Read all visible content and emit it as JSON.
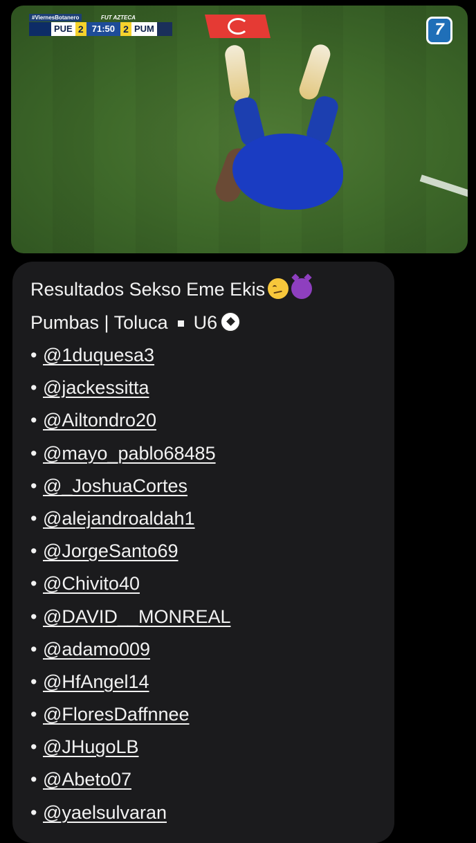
{
  "media": {
    "scoreboard": {
      "hashtag": "#ViernesBotanero",
      "brand": "FUT AZTECA",
      "home_team": "PUE",
      "home_score": "2",
      "clock": "71:50",
      "away_score": "2",
      "away_team": "PUM"
    },
    "channel_number": "7"
  },
  "post": {
    "headline_line1": "Resultados Sekso Eme Ekis",
    "headline_line2_left": "Pumbas | Toluca",
    "headline_line2_right": "U6",
    "emojis": [
      "woozy-face",
      "smiling-devil",
      "soccer-ball"
    ],
    "bullet": "•",
    "mentions": [
      "@1duquesa3",
      "@jackessitta",
      "@Ailtondro20",
      "@mayo_pablo68485",
      "@_JoshuaCortes",
      "@alejandroaldah1",
      "@JorgeSanto69",
      "@Chivito40",
      "@DAVID__MONREAL",
      "@adamo009",
      "@HfAngel14",
      "@FloresDaffnnee",
      "@JHugoLB",
      "@Abeto07",
      "@yaelsulvaran"
    ]
  },
  "colors": {
    "background": "#000000",
    "bubble": "#1b1b1d",
    "text": "#f2f2f2",
    "pitch": "#3f6a2a",
    "kit": "#1a3cc2"
  }
}
